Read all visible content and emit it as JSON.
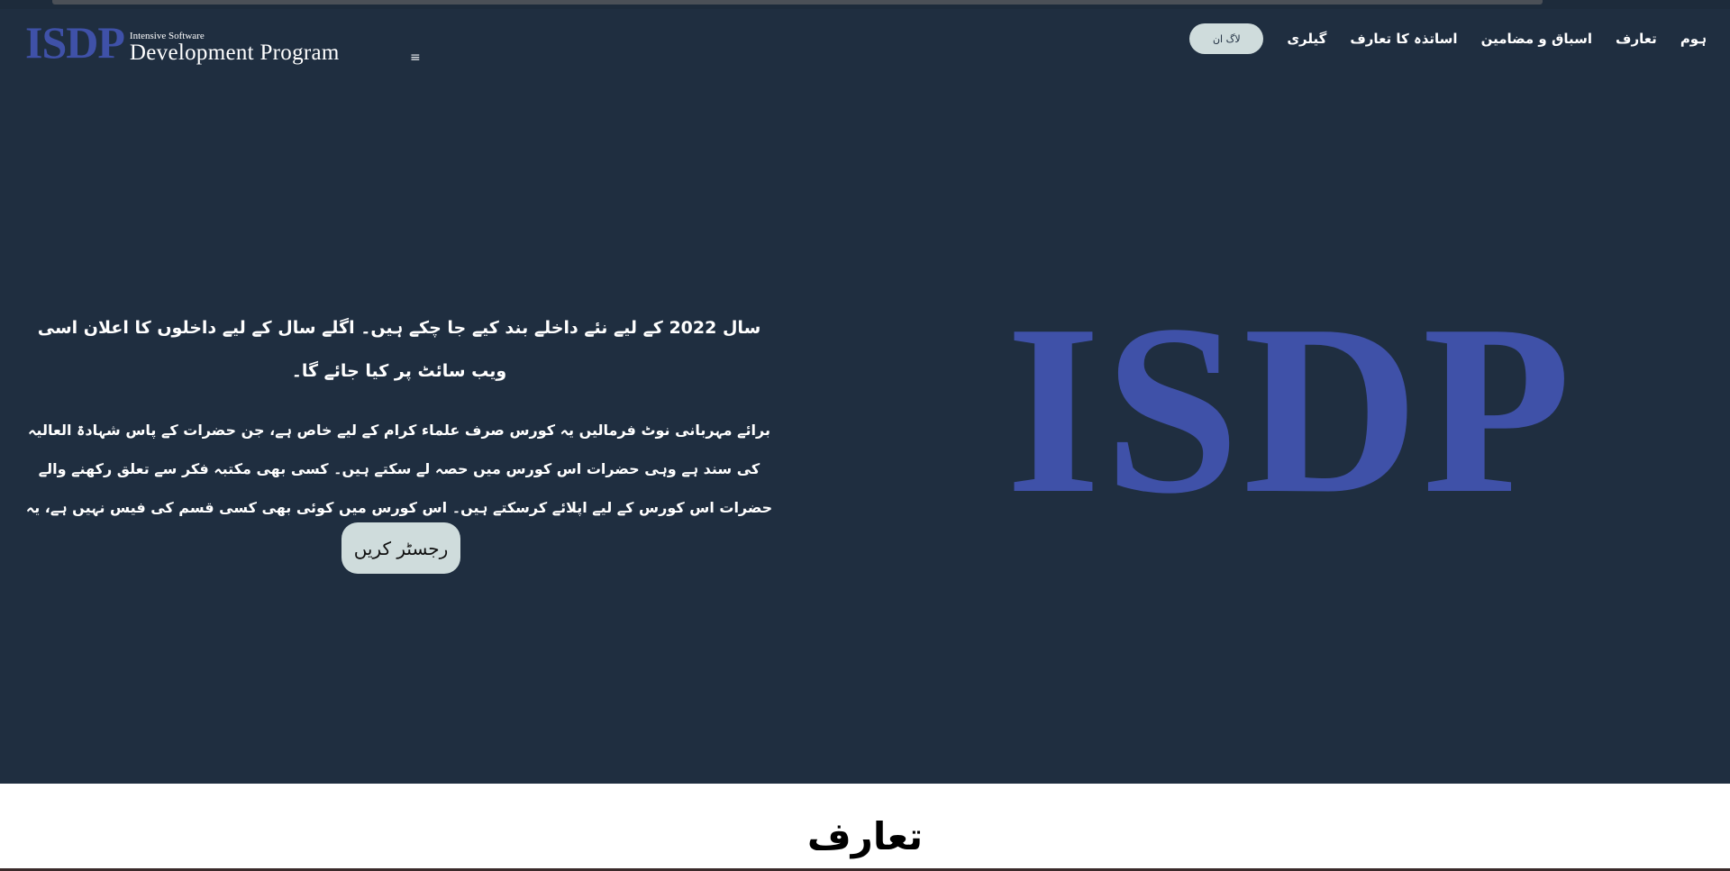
{
  "header": {
    "logo_mark": "ISDP",
    "logo_small": "Intensive Software",
    "logo_big": "Development Program",
    "menu_icon": "≡",
    "login_label": "لاگ ان",
    "nav_items": [
      "گیلری",
      "اساتذہ کا تعارف",
      "اسباق و مضامین",
      "تعارف",
      "ہوم"
    ]
  },
  "hero": {
    "notice": "سال 2022 کے لیے نئے داخلے بند کیے جا چکے ہیں۔ اگلے سال کے لیے داخلوں کا اعلان اسی ویب سائٹ پر کیا جائے گا۔",
    "description": "برائے مہربانی نوٹ فرمالیں یہ کورس صرف علماء کرام کے لیے خاص ہے، جن حضرات کے پاس شہادۃ العالیہ کی سند ہے وہی حضرات اس کورس میں حصہ لے سکتے ہیں۔ کسی بھی مکتبہ فکر سے تعلق رکھنے والے حضرات اس کورس کے لیے اپلائے کرسکتے ہیں۔ اس کورس میں کوئی بھی کسی قسم کی فیس نہیں ہے، یہ بالکل مفت ہے۔",
    "register_label": "رجسٹر کریں",
    "logo_text": "ISDP"
  },
  "intro": {
    "title": "تعارف"
  },
  "colors": {
    "background": "#1f2e40",
    "brand": "#3f51a8",
    "button": "#cfdcdc"
  }
}
